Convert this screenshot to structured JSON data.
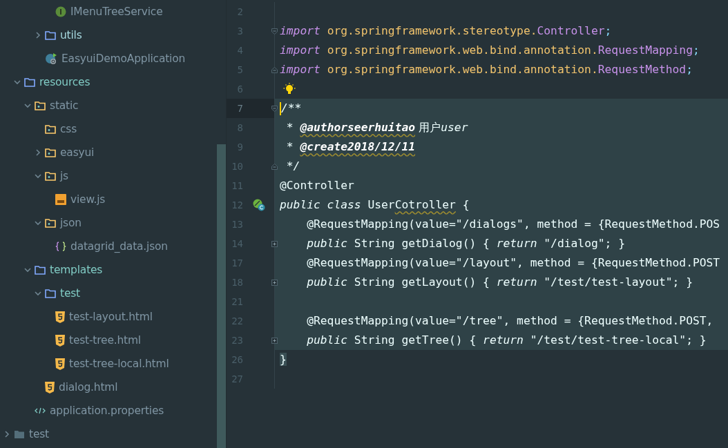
{
  "project_tree": [
    {
      "children": [
        {
          "children": [
            {
              "children": [
                {
                  "children": [
                    {
                      "label": "IMenuTreeService",
                      "kind": "interface",
                      "color": "#7f95a3"
                    }
                  ]
                },
                {
                  "label": "utils",
                  "kind": "folder",
                  "expanded": false,
                  "color": "#a6d8df"
                },
                {
                  "label": "EasyuiDemoApplication",
                  "kind": "spring_app",
                  "color": "#7f95a3"
                }
              ]
            }
          ]
        },
        {
          "label": "resources",
          "kind": "folder",
          "expanded": true,
          "color": "#80cbc4",
          "children": [
            {
              "label": "static",
              "kind": "resource_folder",
              "expanded": true,
              "color": "#7f95a3",
              "children": [
                {
                  "label": "css",
                  "kind": "resource_folder",
                  "color": "#7f95a3"
                },
                {
                  "label": "easyui",
                  "kind": "resource_folder",
                  "expanded": false,
                  "color": "#7f95a3"
                },
                {
                  "label": "js",
                  "kind": "resource_folder",
                  "expanded": true,
                  "color": "#7f95a3",
                  "children": [
                    {
                      "label": "view.js",
                      "kind": "js",
                      "color": "#7f95a3"
                    }
                  ]
                },
                {
                  "label": "json",
                  "kind": "resource_folder",
                  "expanded": true,
                  "color": "#7f95a3",
                  "children": [
                    {
                      "label": "datagrid_data.json",
                      "kind": "json",
                      "color": "#7f95a3"
                    }
                  ]
                }
              ]
            },
            {
              "label": "templates",
              "kind": "folder",
              "expanded": true,
              "color": "#80cbc4",
              "children": [
                {
                  "label": "test",
                  "kind": "folder",
                  "expanded": true,
                  "color": "#80cbc4",
                  "children": [
                    {
                      "label": "test-layout.html",
                      "kind": "html",
                      "color": "#7f95a3"
                    },
                    {
                      "label": "test-tree.html",
                      "kind": "html",
                      "color": "#7f95a3"
                    },
                    {
                      "label": "test-tree-local.html",
                      "kind": "html",
                      "color": "#7f95a3"
                    }
                  ]
                },
                {
                  "label": "dialog.html",
                  "kind": "html",
                  "color": "#7f95a3"
                }
              ]
            },
            {
              "label": "application.properties",
              "kind": "properties",
              "color": "#7f95a3"
            }
          ]
        }
      ]
    },
    {
      "label": "test",
      "kind": "plain_folder",
      "expanded": false,
      "color": "#7f95a3"
    }
  ],
  "editor": {
    "lines": [
      {
        "number": "2",
        "highlighted": false
      },
      {
        "number": "3",
        "highlighted": false,
        "markers": [
          {
            "kind": "fold_start"
          }
        ],
        "tokens": [
          {
            "kind": "keyword",
            "text": "import"
          },
          {
            "kind": "package",
            "text": " org.springframework.stereotype."
          },
          {
            "kind": "type",
            "text": "Controller"
          },
          {
            "kind": "punct",
            "text": ";"
          }
        ]
      },
      {
        "number": "4",
        "highlighted": false,
        "tokens": [
          {
            "kind": "keyword",
            "text": "import"
          },
          {
            "kind": "package",
            "text": " org.springframework.web.bind.annotation."
          },
          {
            "kind": "type",
            "text": "RequestMapping"
          },
          {
            "kind": "punct",
            "text": ";"
          }
        ]
      },
      {
        "number": "5",
        "highlighted": false,
        "markers": [
          {
            "kind": "fold_end"
          }
        ],
        "tokens": [
          {
            "kind": "keyword",
            "text": "import"
          },
          {
            "kind": "package",
            "text": " org.springframework.web.bind.annotation."
          },
          {
            "kind": "type",
            "text": "RequestMethod"
          },
          {
            "kind": "punct",
            "text": ";"
          }
        ]
      },
      {
        "number": "6",
        "highlighted": false,
        "markers": [
          {
            "kind": "lightbulb"
          }
        ]
      },
      {
        "number": "7",
        "highlighted": true,
        "current": true,
        "markers": [
          {
            "kind": "fold_start"
          }
        ],
        "tokens": [
          {
            "kind": "comment",
            "text": "/**"
          }
        ]
      },
      {
        "number": "8",
        "highlighted": true,
        "tokens": [
          {
            "kind": "comment",
            "text": " * "
          },
          {
            "kind": "doctag",
            "text": "@authorseerhuitao"
          },
          {
            "kind": "cjk",
            "text": " 用户"
          },
          {
            "kind": "comment",
            "text": "user"
          }
        ]
      },
      {
        "number": "9",
        "highlighted": true,
        "tokens": [
          {
            "kind": "comment",
            "text": " * "
          },
          {
            "kind": "doctag",
            "text": "@create2018/12/11"
          }
        ]
      },
      {
        "number": "10",
        "highlighted": true,
        "markers": [
          {
            "kind": "fold_end"
          }
        ],
        "tokens": [
          {
            "kind": "comment",
            "text": " */"
          }
        ]
      },
      {
        "number": "11",
        "highlighted": true,
        "tokens": [
          {
            "kind": "plain",
            "text": "@Controller"
          }
        ]
      },
      {
        "number": "12",
        "highlighted": true,
        "markers": [
          {
            "kind": "spring_bean"
          }
        ],
        "tokens": [
          {
            "kind": "keyword",
            "text": "public class"
          },
          {
            "kind": "plain",
            "text": " User"
          },
          {
            "kind": "typo",
            "text": "Cotroller"
          },
          {
            "kind": "plain",
            "text": " {"
          }
        ]
      },
      {
        "number": "13",
        "highlighted": true,
        "tokens": [
          {
            "kind": "plain",
            "text": "    @RequestMapping(value=\"/dialogs\", method = {RequestMethod.POS"
          }
        ]
      },
      {
        "number": "14",
        "highlighted": true,
        "markers": [
          {
            "kind": "collapsed"
          }
        ],
        "tokens": [
          {
            "kind": "keyword",
            "text": "    public"
          },
          {
            "kind": "plain",
            "text": " String getDialog() { "
          },
          {
            "kind": "keyword",
            "text": "return"
          },
          {
            "kind": "plain",
            "text": " \"/dialog\"; }"
          }
        ]
      },
      {
        "number": "17",
        "highlighted": true,
        "tokens": [
          {
            "kind": "plain",
            "text": "    @RequestMapping(value=\"/layout\", method = {RequestMethod.POST"
          }
        ]
      },
      {
        "number": "18",
        "highlighted": true,
        "markers": [
          {
            "kind": "collapsed"
          }
        ],
        "tokens": [
          {
            "kind": "keyword",
            "text": "    public"
          },
          {
            "kind": "plain",
            "text": " String getLayout() { "
          },
          {
            "kind": "keyword",
            "text": "return"
          },
          {
            "kind": "plain",
            "text": " \"/test/test-layout\"; }"
          }
        ]
      },
      {
        "number": "21",
        "highlighted": true
      },
      {
        "number": "22",
        "highlighted": true,
        "tokens": [
          {
            "kind": "plain",
            "text": "    @RequestMapping(value=\"/tree\", method = {RequestMethod.POST,"
          }
        ]
      },
      {
        "number": "23",
        "highlighted": true,
        "markers": [
          {
            "kind": "collapsed"
          }
        ],
        "tokens": [
          {
            "kind": "keyword",
            "text": "    public"
          },
          {
            "kind": "plain",
            "text": " String getTree() { "
          },
          {
            "kind": "keyword",
            "text": "return"
          },
          {
            "kind": "plain",
            "text": " \"/test/test-tree-local\"; }"
          }
        ]
      },
      {
        "number": "26",
        "highlighted": false,
        "tokens": [
          {
            "kind": "brace",
            "text": "}"
          }
        ]
      },
      {
        "number": "27",
        "highlighted": false
      }
    ]
  }
}
